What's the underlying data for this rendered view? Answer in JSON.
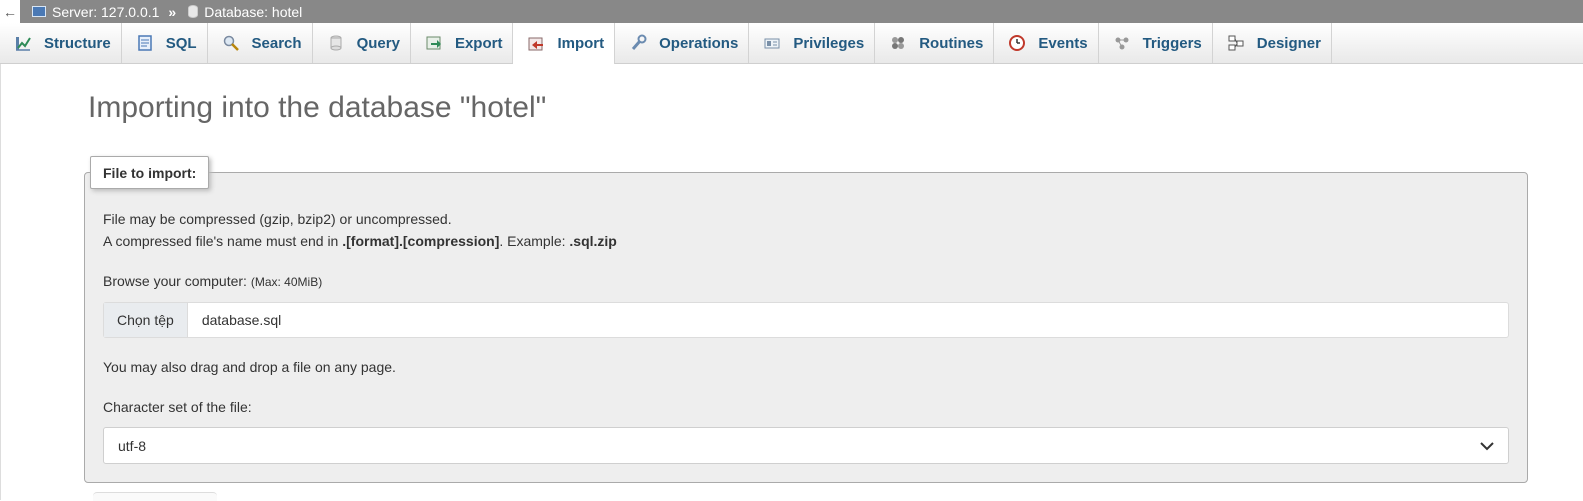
{
  "breadcrumb": {
    "back": "←",
    "server": "Server: 127.0.0.1",
    "separator": "»",
    "database": "Database: hotel"
  },
  "tabs": [
    {
      "label": "Structure",
      "icon": "structure-icon"
    },
    {
      "label": "SQL",
      "icon": "sql-icon"
    },
    {
      "label": "Search",
      "icon": "search-icon"
    },
    {
      "label": "Query",
      "icon": "query-icon"
    },
    {
      "label": "Export",
      "icon": "export-icon"
    },
    {
      "label": "Import",
      "icon": "import-icon",
      "active": true
    },
    {
      "label": "Operations",
      "icon": "wrench-icon"
    },
    {
      "label": "Privileges",
      "icon": "privileges-icon"
    },
    {
      "label": "Routines",
      "icon": "routines-icon"
    },
    {
      "label": "Events",
      "icon": "clock-icon"
    },
    {
      "label": "Triggers",
      "icon": "triggers-icon"
    },
    {
      "label": "Designer",
      "icon": "designer-icon"
    }
  ],
  "page": {
    "title": "Importing into the database \"hotel\""
  },
  "import": {
    "legend": "File to import:",
    "info_line1": "File may be compressed (gzip, bzip2) or uncompressed.",
    "info_line2_pre": "A compressed file's name must end in ",
    "info_line2_format": ".[format].[compression]",
    "info_line2_mid": ". Example: ",
    "info_line2_example": ".sql.zip",
    "browse_label": "Browse your computer: ",
    "browse_max": "(Max: 40MiB)",
    "choose_button": "Chọn tệp",
    "file_name": "database.sql",
    "drag_drop": "You may also drag and drop a file on any page.",
    "charset_label": "Character set of the file:",
    "charset_value": "utf-8"
  }
}
